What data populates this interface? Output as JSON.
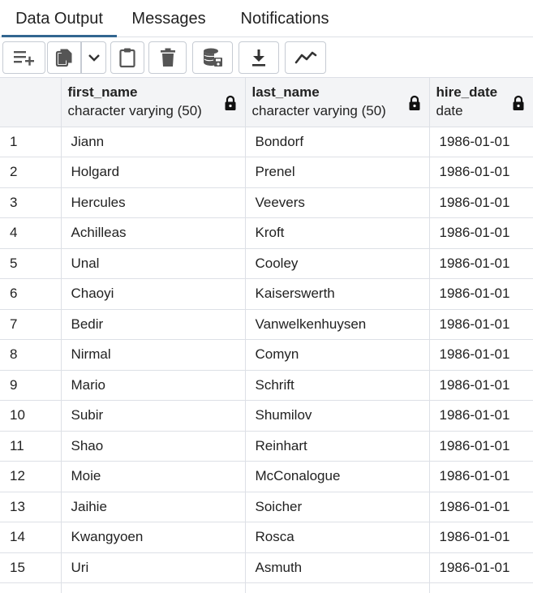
{
  "tabs": [
    {
      "label": "Data Output",
      "active": true
    },
    {
      "label": "Messages",
      "active": false
    },
    {
      "label": "Notifications",
      "active": false
    }
  ],
  "toolbar": {
    "icons": [
      "add-row-icon",
      "copy-icon",
      "chevron-down-icon",
      "paste-icon",
      "trash-icon",
      "save-data-icon",
      "download-icon",
      "graph-icon"
    ]
  },
  "columns": [
    {
      "name": "first_name",
      "type": "character varying (50)"
    },
    {
      "name": "last_name",
      "type": "character varying (50)"
    },
    {
      "name": "hire_date",
      "type": "date"
    }
  ],
  "rows": [
    {
      "num": "1",
      "first_name": "Jiann",
      "last_name": "Bondorf",
      "hire_date": "1986-01-01"
    },
    {
      "num": "2",
      "first_name": "Holgard",
      "last_name": "Prenel",
      "hire_date": "1986-01-01"
    },
    {
      "num": "3",
      "first_name": "Hercules",
      "last_name": "Veevers",
      "hire_date": "1986-01-01"
    },
    {
      "num": "4",
      "first_name": "Achilleas",
      "last_name": "Kroft",
      "hire_date": "1986-01-01"
    },
    {
      "num": "5",
      "first_name": "Unal",
      "last_name": "Cooley",
      "hire_date": "1986-01-01"
    },
    {
      "num": "6",
      "first_name": "Chaoyi",
      "last_name": "Kaiserswerth",
      "hire_date": "1986-01-01"
    },
    {
      "num": "7",
      "first_name": "Bedir",
      "last_name": "Vanwelkenhuysen",
      "hire_date": "1986-01-01"
    },
    {
      "num": "8",
      "first_name": "Nirmal",
      "last_name": "Comyn",
      "hire_date": "1986-01-01"
    },
    {
      "num": "9",
      "first_name": "Mario",
      "last_name": "Schrift",
      "hire_date": "1986-01-01"
    },
    {
      "num": "10",
      "first_name": "Subir",
      "last_name": "Shumilov",
      "hire_date": "1986-01-01"
    },
    {
      "num": "11",
      "first_name": "Shao",
      "last_name": "Reinhart",
      "hire_date": "1986-01-01"
    },
    {
      "num": "12",
      "first_name": "Moie",
      "last_name": "McConalogue",
      "hire_date": "1986-01-01"
    },
    {
      "num": "13",
      "first_name": "Jaihie",
      "last_name": "Soicher",
      "hire_date": "1986-01-01"
    },
    {
      "num": "14",
      "first_name": "Kwangyoen",
      "last_name": "Rosca",
      "hire_date": "1986-01-01"
    },
    {
      "num": "15",
      "first_name": "Uri",
      "last_name": "Asmuth",
      "hire_date": "1986-01-01"
    },
    {
      "num": "",
      "first_name": "",
      "last_name": "",
      "hire_date": ""
    }
  ],
  "colors": {
    "active_tab_underline": "#326690",
    "header_bg": "#f3f4f6",
    "grid_line": "#dde0e6"
  }
}
